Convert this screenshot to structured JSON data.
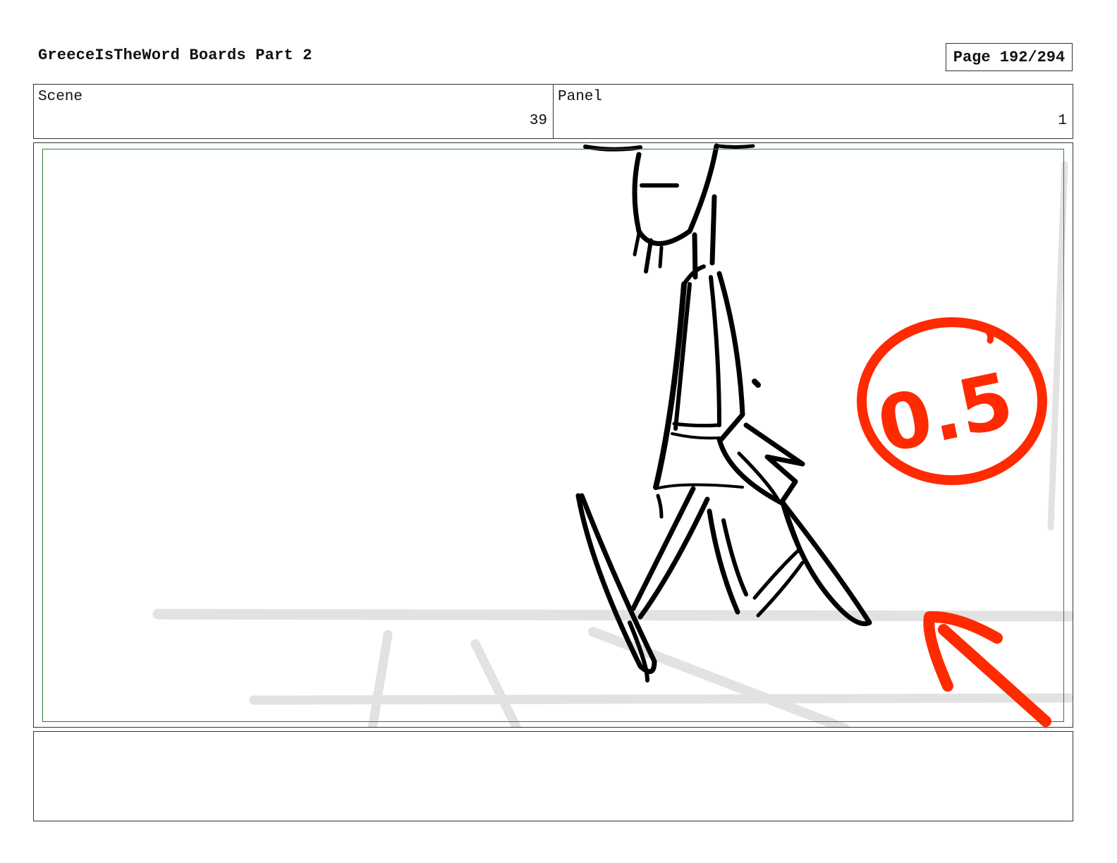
{
  "document": {
    "title": "GreeceIsTheWord Boards Part 2",
    "page_label": "Page 192/294"
  },
  "info": {
    "scene_label": "Scene",
    "scene_value": "39",
    "panel_label": "Panel",
    "panel_value": "1"
  },
  "drawing": {
    "timing_note": "0.5",
    "sketch_color": "#000000",
    "annotation_color": "#ff2a00",
    "guide_color": "#e2e2e2",
    "safe_area_color": "#2e7d32"
  },
  "notes": {
    "text": ""
  }
}
